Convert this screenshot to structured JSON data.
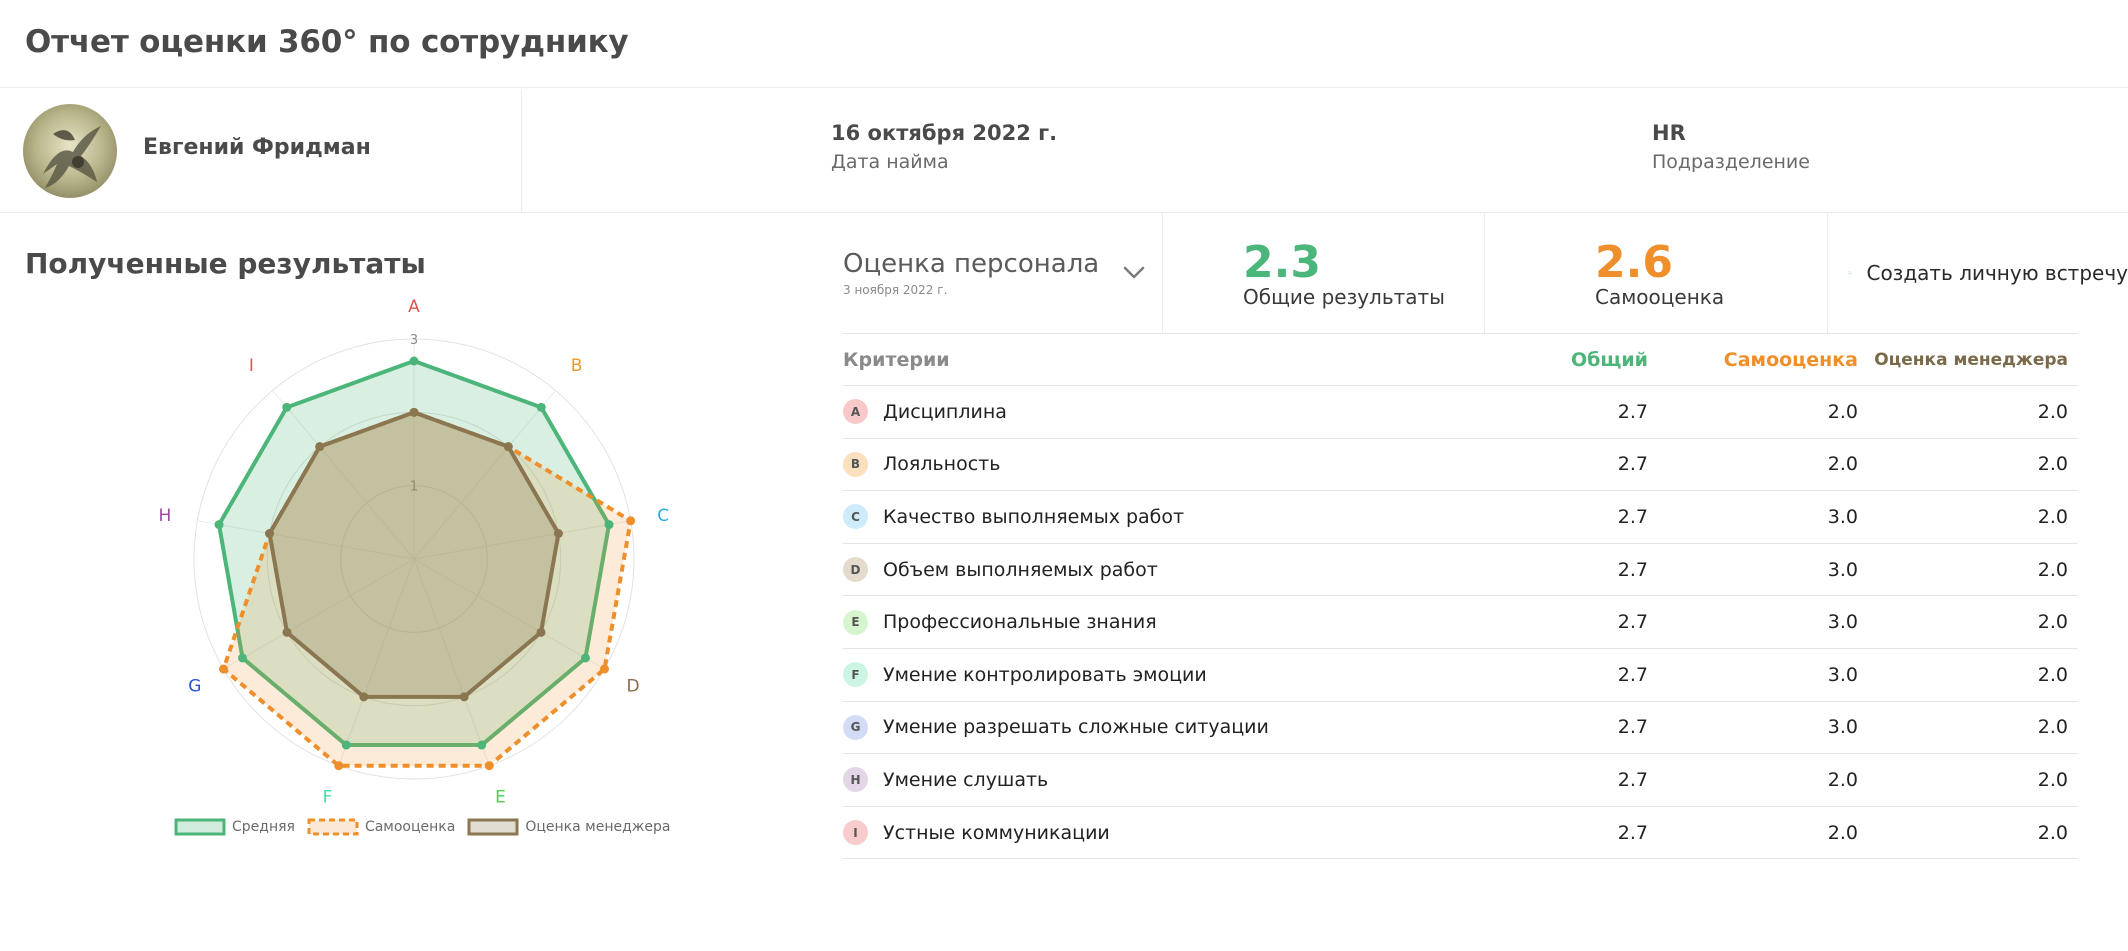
{
  "page": {
    "title": "Отчет оценки 360° по сотруднику"
  },
  "employee": {
    "name": "Евгений Фридман",
    "hire_date": "16 октября 2022 г.",
    "hire_date_label": "Дата найма",
    "department": "HR",
    "department_label": "Подразделение"
  },
  "results": {
    "title": "Полученные результаты"
  },
  "evaluation": {
    "title": "Оценка персонала",
    "date": "3 ноября 2022 г.",
    "overall_value": "2.3",
    "overall_label": "Общие результаты",
    "self_value": "2.6",
    "self_label": "Самооценка",
    "meeting_button": "Создать личную встречу"
  },
  "table": {
    "headers": {
      "criteria": "Критерии",
      "total": "Общий",
      "self": "Самооценка",
      "manager": "Оценка менеджера"
    },
    "rows": [
      {
        "letter": "A",
        "name": "Дисциплина",
        "total": "2.7",
        "self": "2.0",
        "manager": "2.0",
        "color": "#f7c9c9"
      },
      {
        "letter": "B",
        "name": "Лояльность",
        "total": "2.7",
        "self": "2.0",
        "manager": "2.0",
        "color": "#fbe0bf"
      },
      {
        "letter": "C",
        "name": "Качество выполняемых работ",
        "total": "2.7",
        "self": "3.0",
        "manager": "2.0",
        "color": "#cdebf8"
      },
      {
        "letter": "D",
        "name": "Объем выполняемых работ",
        "total": "2.7",
        "self": "3.0",
        "manager": "2.0",
        "color": "#e3dccd"
      },
      {
        "letter": "E",
        "name": "Профессиональные знания",
        "total": "2.7",
        "self": "3.0",
        "manager": "2.0",
        "color": "#d6f5cf"
      },
      {
        "letter": "F",
        "name": "Умение контролировать эмоции",
        "total": "2.7",
        "self": "3.0",
        "manager": "2.0",
        "color": "#cdf5e3"
      },
      {
        "letter": "G",
        "name": "Умение разрешать сложные ситуации",
        "total": "2.7",
        "self": "3.0",
        "manager": "2.0",
        "color": "#d3dbf5"
      },
      {
        "letter": "H",
        "name": "Умение слушать",
        "total": "2.7",
        "self": "2.0",
        "manager": "2.0",
        "color": "#e3d6e6"
      },
      {
        "letter": "I",
        "name": "Устные коммуникации",
        "total": "2.7",
        "self": "2.0",
        "manager": "2.0",
        "color": "#f7cccc"
      }
    ]
  },
  "chart_data": {
    "type": "radar",
    "axes": [
      "A",
      "B",
      "C",
      "D",
      "E",
      "F",
      "G",
      "H",
      "I"
    ],
    "axis_colors": [
      "#e05252",
      "#ee9a2b",
      "#2aaee0",
      "#8a6d4a",
      "#4ccf4c",
      "#3ee0a0",
      "#2a4fe0",
      "#9a4a9a",
      "#e05252"
    ],
    "tick_labels": [
      "1",
      "3"
    ],
    "r_max": 3,
    "series": [
      {
        "name": "Средняя",
        "values": [
          2.7,
          2.7,
          2.7,
          2.7,
          2.7,
          2.7,
          2.7,
          2.7,
          2.7
        ],
        "color": "#4cb579"
      },
      {
        "name": "Самооценка",
        "values": [
          2.0,
          2.0,
          3.0,
          3.0,
          3.0,
          3.0,
          3.0,
          2.0,
          2.0
        ],
        "color": "#ee8f2b"
      },
      {
        "name": "Оценка менеджера",
        "values": [
          2.0,
          2.0,
          2.0,
          2.0,
          2.0,
          2.0,
          2.0,
          2.0,
          2.0
        ],
        "color": "#8a7650"
      }
    ],
    "legend_position": "bottom"
  }
}
